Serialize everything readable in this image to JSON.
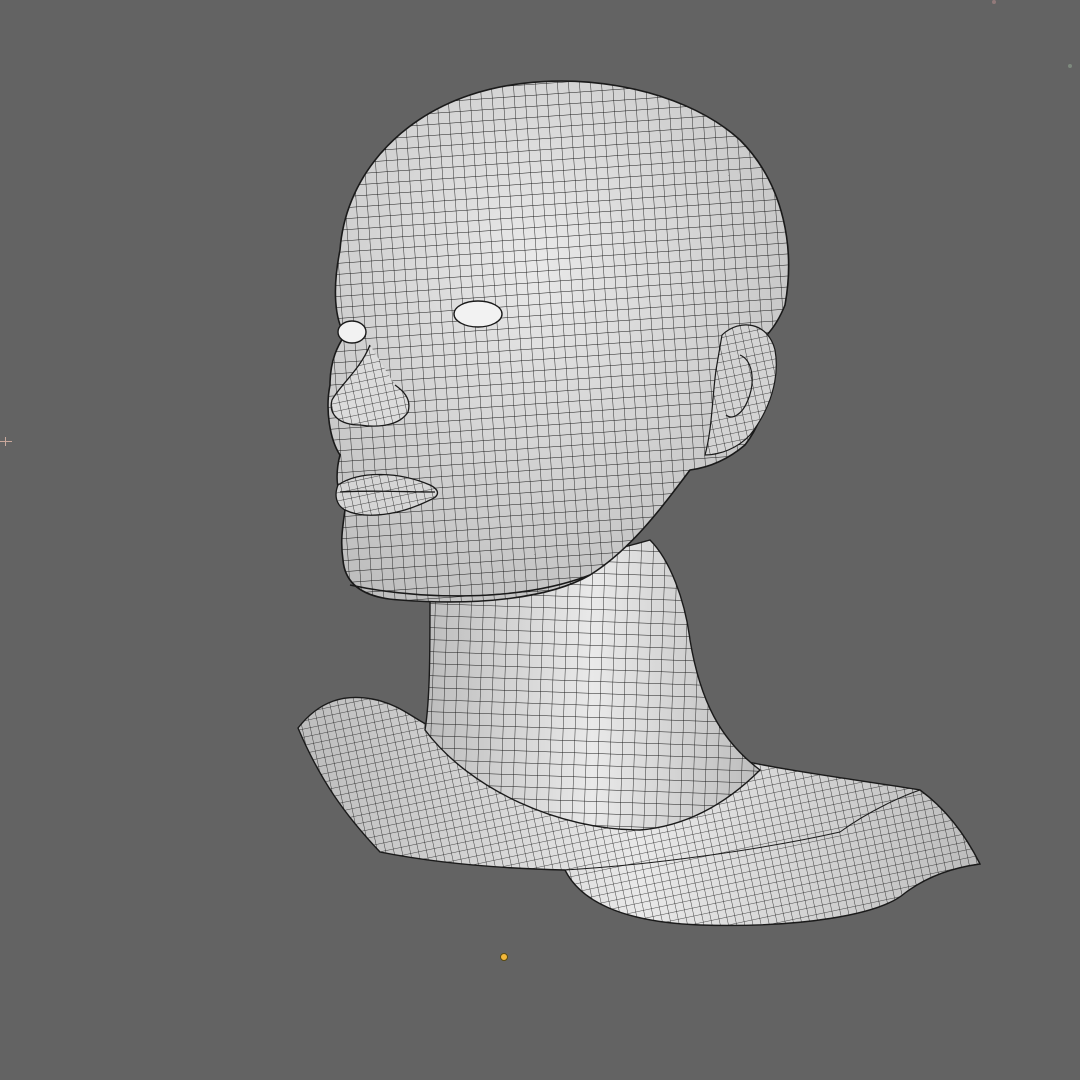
{
  "viewport": {
    "background_color": "#636363",
    "mesh_fill_color": "#e9e9e9",
    "mesh_shade_color": "#bdbdbd",
    "wire_color": "#1a1a1a",
    "origin_color": "#f3b83a",
    "axis_color": "#c9a89c",
    "speck_colors": [
      "#b38a8a",
      "#8fa38f"
    ]
  },
  "objects": [
    {
      "name": "head-bust-mesh",
      "shading": "solid",
      "overlay": "wireframe"
    }
  ]
}
